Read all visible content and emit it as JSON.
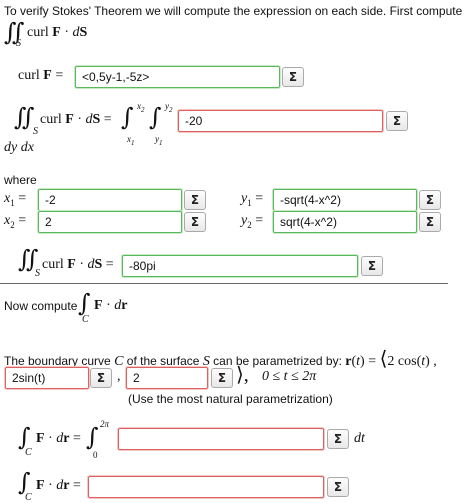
{
  "intro": "To verify Stokes' Theorem we will compute the expression on each side. First compute",
  "sigma_glyph": "Σ",
  "curlF": {
    "value": "<0,5y-1,-5z>"
  },
  "inner_integral": {
    "value": "-20"
  },
  "where_label": "where",
  "limits": {
    "x1": "-2",
    "x2": "2",
    "y1": "-sqrt(4-x^2)",
    "y2": "sqrt(4-x^2)"
  },
  "surface_integral": {
    "value": "-80pi"
  },
  "now_compute": "Now compute",
  "boundary_text": "The boundary curve",
  "boundary_text2": "of the surface",
  "boundary_text3": "can be parametrized by:",
  "r_x": {
    "value": "2sin(t)"
  },
  "r_y": {
    "value": "2"
  },
  "range_text": "0 ≤ t ≤ 2π",
  "natural_note": "(Use the most natural parametrization)",
  "line_integrand": {
    "value": ""
  },
  "line_integral": {
    "value": ""
  }
}
